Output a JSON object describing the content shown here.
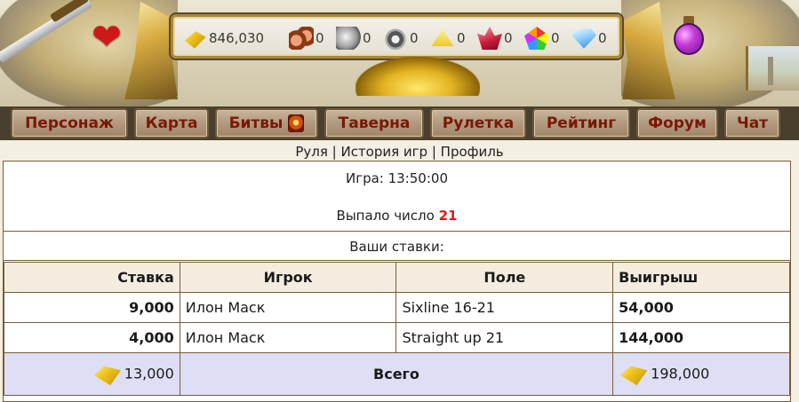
{
  "resources": [
    {
      "icon": "gold-bars-icon",
      "value": "846,030"
    },
    {
      "icon": "wood-logs-icon",
      "value": "0"
    },
    {
      "icon": "stone-icon",
      "value": "0"
    },
    {
      "icon": "iron-ore-icon",
      "value": "0"
    },
    {
      "icon": "sulfur-icon",
      "value": "0"
    },
    {
      "icon": "crystal-icon",
      "value": "0"
    },
    {
      "icon": "gems-icon",
      "value": "0"
    },
    {
      "icon": "diamond-icon",
      "value": "0"
    }
  ],
  "nav": {
    "character": "Персонаж",
    "map": "Карта",
    "battles": "Битвы",
    "tavern": "Таверна",
    "roulette": "Рулетка",
    "rating": "Рейтинг",
    "forum": "Форум",
    "chat": "Чат"
  },
  "sublinks": {
    "roulette": "Руля",
    "sep1": " | ",
    "history": "История игр",
    "sep2": " | ",
    "profile": "Профиль"
  },
  "game": {
    "time_label": "Игра: 13:50:00",
    "drop_label": "Выпало число ",
    "drop_number": "21"
  },
  "bets_title": "Ваши ставки:",
  "table": {
    "headers": {
      "bet": "Ставка",
      "player": "Игрок",
      "field": "Поле",
      "win": "Выигрыш"
    },
    "rows": [
      {
        "bet": "9,000",
        "player": "Илон Маск",
        "field": "Sixline 16-21",
        "win": "54,000"
      },
      {
        "bet": "4,000",
        "player": "Илон Маск",
        "field": "Straight up 21",
        "win": "144,000"
      }
    ],
    "total": {
      "bet": "13,000",
      "label": "Всего",
      "win": "198,000"
    }
  },
  "colors": {
    "nav_text": "#7a1808",
    "drop_number": "#e11a1a",
    "total_row": "#dedff5",
    "header_row": "#f4ecde"
  }
}
